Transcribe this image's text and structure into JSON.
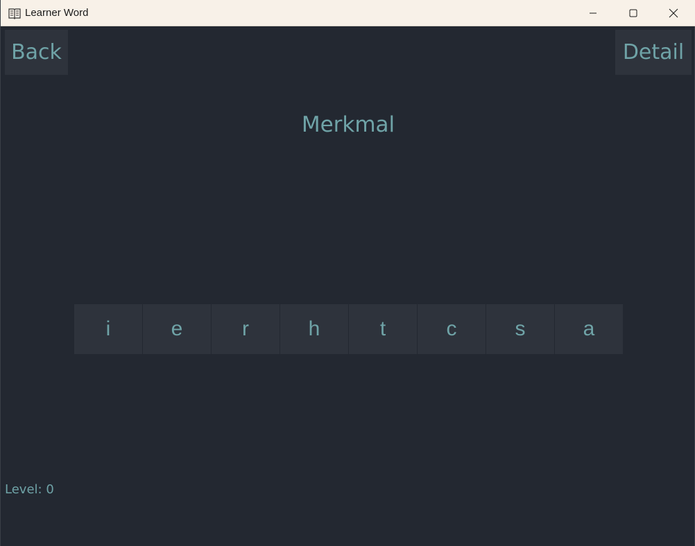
{
  "window": {
    "title": "Learner Word",
    "icon": "book-icon"
  },
  "controls": {
    "minimize_icon": "minimize-icon",
    "maximize_icon": "maximize-icon",
    "close_icon": "close-icon"
  },
  "toolbar": {
    "back_label": "Back",
    "detail_label": "Detail"
  },
  "word": "Merkmal",
  "letters": [
    "i",
    "e",
    "r",
    "h",
    "t",
    "c",
    "s",
    "a"
  ],
  "level": {
    "label": "Level:",
    "value": "0"
  },
  "colors": {
    "background": "#232831",
    "tile": "#2e333c",
    "text_accent": "#6fa3a7",
    "titlebar": "#f8f1e8"
  }
}
